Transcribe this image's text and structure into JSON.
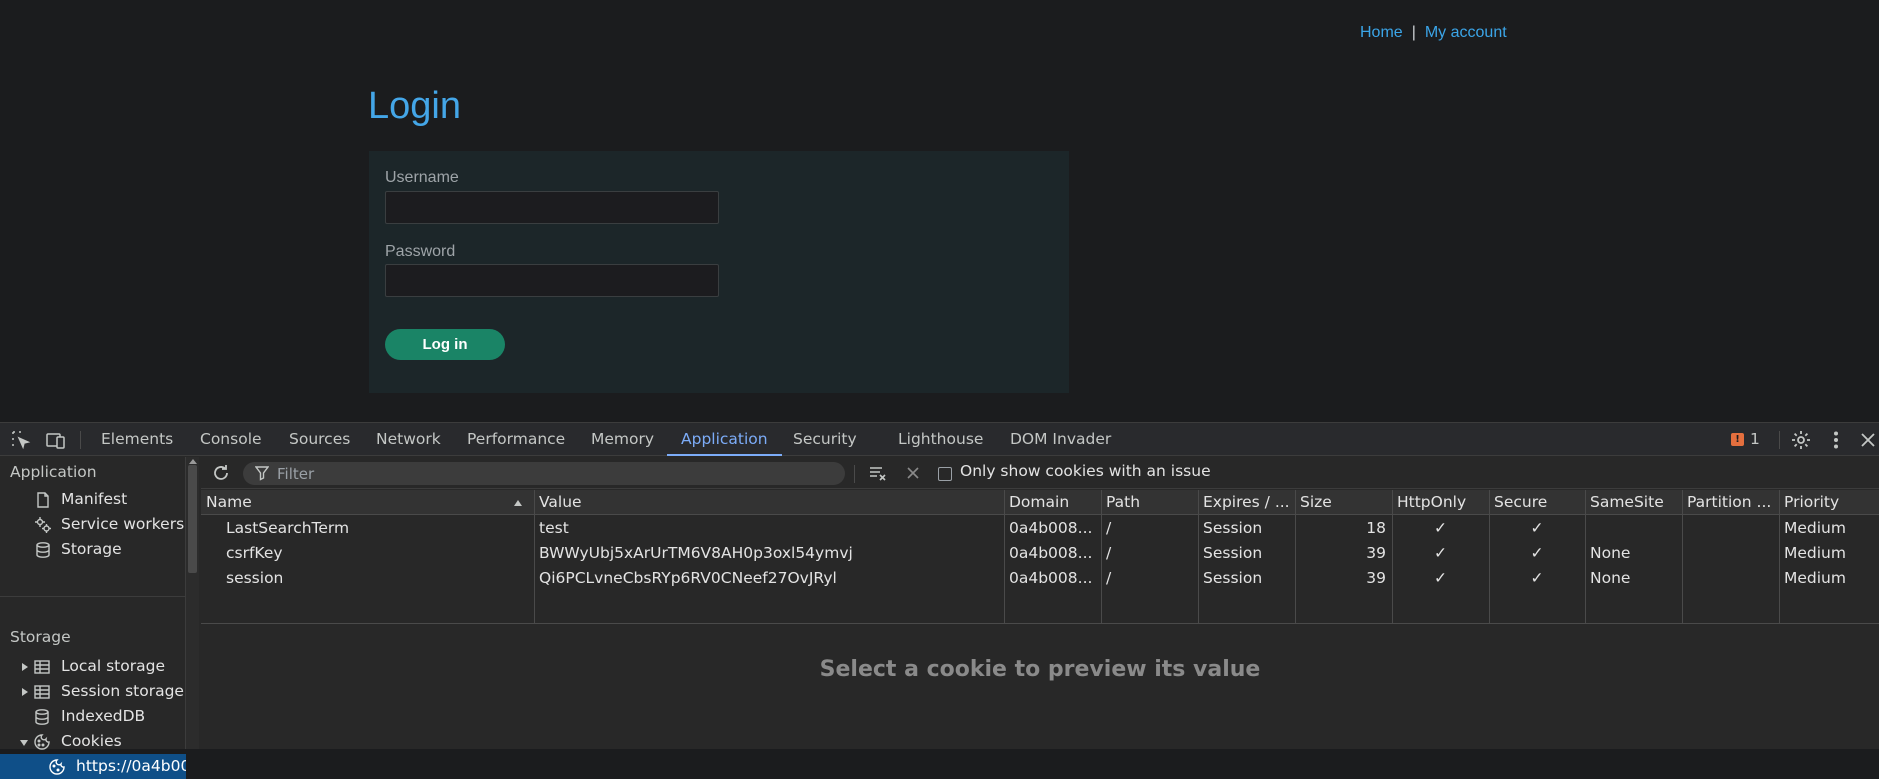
{
  "page": {
    "nav": {
      "home": "Home",
      "separator": "|",
      "account": "My account"
    },
    "title": "Login",
    "username_label": "Username",
    "password_label": "Password",
    "username_value": "",
    "password_value": "",
    "login_button": "Log in"
  },
  "devtools": {
    "tabs": [
      "Elements",
      "Console",
      "Sources",
      "Network",
      "Performance",
      "Memory",
      "Application",
      "Security",
      "Lighthouse",
      "DOM Invader"
    ],
    "active_tab": "Application",
    "issues_count": "1",
    "sidebar": {
      "application_header": "Application",
      "application_items": [
        "Manifest",
        "Service workers",
        "Storage"
      ],
      "storage_header": "Storage",
      "storage_items": [
        "Local storage",
        "Session storage",
        "IndexedDB",
        "Cookies"
      ],
      "cookie_origin": "https://0a4b00"
    },
    "toolbar": {
      "filter_placeholder": "Filter",
      "only_issues_label": "Only show cookies with an issue",
      "only_issues_checked": false
    },
    "table": {
      "columns": [
        "Name",
        "Value",
        "Domain",
        "Path",
        "Expires / ...",
        "Size",
        "HttpOnly",
        "Secure",
        "SameSite",
        "Partition ...",
        "Priority"
      ],
      "rows": [
        {
          "name": "LastSearchTerm",
          "value": "test",
          "domain": "0a4b008...",
          "path": "/",
          "expires": "Session",
          "size": "18",
          "httponly": "✓",
          "secure": "✓",
          "samesite": "",
          "partition": "",
          "priority": "Medium"
        },
        {
          "name": "csrfKey",
          "value": "BWWyUbj5xArUrTM6V8AH0p3oxl54ymvj",
          "domain": "0a4b008...",
          "path": "/",
          "expires": "Session",
          "size": "39",
          "httponly": "✓",
          "secure": "✓",
          "samesite": "None",
          "partition": "",
          "priority": "Medium"
        },
        {
          "name": "session",
          "value": "Qi6PCLvneCbsRYp6RV0CNeef27OvJRyl",
          "domain": "0a4b008...",
          "path": "/",
          "expires": "Session",
          "size": "39",
          "httponly": "✓",
          "secure": "✓",
          "samesite": "None",
          "partition": "",
          "priority": "Medium"
        }
      ]
    },
    "preview_text": "Select a cookie to preview its value"
  },
  "colors": {
    "link": "#3ba5e8",
    "title": "#44a6e8",
    "button": "#1a8466",
    "active_tab": "#7cacf8",
    "selected_row": "#0f4f88",
    "issue_badge": "#e46f3e"
  },
  "icons": {
    "toolbar": [
      "inspect-element-icon",
      "device-toggle-icon",
      "settings-gear-icon",
      "more-vertical-icon",
      "close-icon"
    ],
    "sidebar": [
      "document-icon",
      "gears-icon",
      "database-icon",
      "table-grid-icon",
      "cookie-icon"
    ],
    "main_toolbar": [
      "refresh-icon",
      "filter-funnel-icon",
      "clear-filtered-icon",
      "delete-x-icon"
    ]
  }
}
